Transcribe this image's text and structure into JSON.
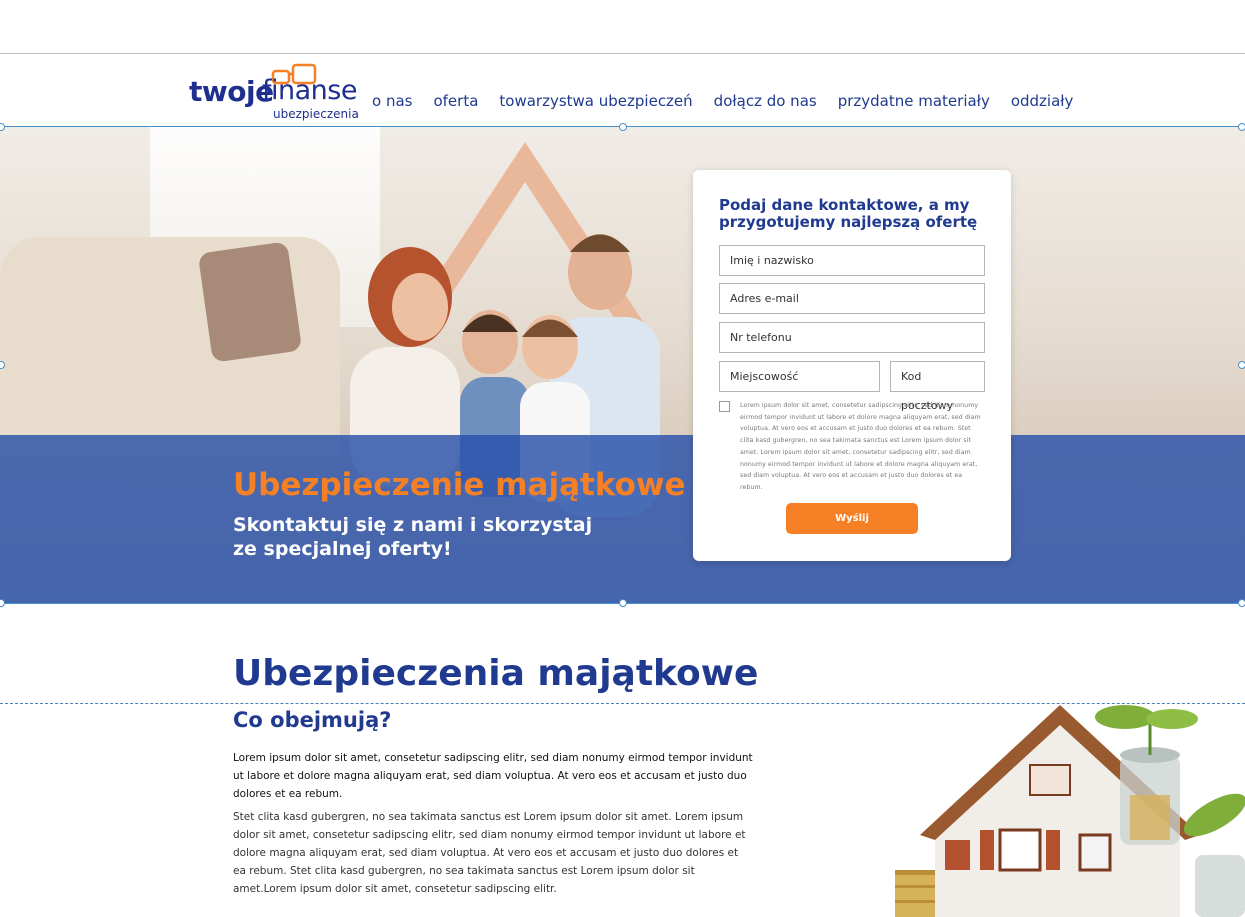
{
  "header": {
    "logo": {
      "main": "twoje",
      "accent": "finanse",
      "sub": "ubezpieczenia"
    },
    "nav": [
      "o nas",
      "oferta",
      "towarzystwa ubezpieczeń",
      "dołącz do nas",
      "przydatne materiały",
      "oddziały"
    ]
  },
  "hero": {
    "title": "Ubezpieczenie majątkowe",
    "subtitle_line1": "Skontaktuj się z nami i skorzystaj",
    "subtitle_line2": "ze specjalnej oferty!"
  },
  "form": {
    "title": "Podaj dane kontaktowe, a my przygotujemy najlepszą ofertę",
    "fields": {
      "name": "Imię i nazwisko",
      "email": "Adres e-mail",
      "phone": "Nr telefonu",
      "city": "Miejscowość",
      "postal": "Kod pocztowy"
    },
    "consent": "Lorem ipsum dolor sit amet, consetetur sadipscing elitr, sed diam nonumy eirmod tempor invidunt ut labore et dolore magna aliquyam erat, sed diam voluptua. At vero eos et accusam et justo duo dolores et ea rebum. Stet clita kasd gubergren, no sea takimata sanctus est Lorem ipsum dolor sit amet. Lorem ipsum dolor sit amet, consetetur sadipscing elitr, sed diam nonumy eirmod tempor invidunt ut labore et dolore magna aliquyam erat, sed diam voluptua. At vero eos et accusam et justo duo dolores et ea rebum.",
    "submit": "Wyślij"
  },
  "content": {
    "heading": "Ubezpieczenia majątkowe",
    "subheading": "Co obejmują?",
    "p1": "Lorem ipsum dolor sit amet, consetetur sadipscing elitr, sed diam nonumy eirmod tempor invidunt ut labore et dolore magna aliquyam erat, sed diam voluptua. At vero eos et accusam et justo duo dolores et ea rebum.",
    "p2": "Stet clita kasd gubergren, no sea takimata sanctus est Lorem ipsum dolor sit amet. Lorem ipsum dolor sit amet, consetetur sadipscing elitr, sed diam nonumy eirmod tempor invidunt ut labore et dolore magna aliquyam erat, sed diam voluptua. At vero eos et accusam et justo duo dolores et ea rebum. Stet clita kasd gubergren, no sea takimata sanctus est Lorem ipsum dolor sit amet.Lorem ipsum dolor sit amet, consetetur sadipscing elitr."
  },
  "colors": {
    "brand_blue": "#1f3a8f",
    "accent_orange": "#f58025"
  }
}
